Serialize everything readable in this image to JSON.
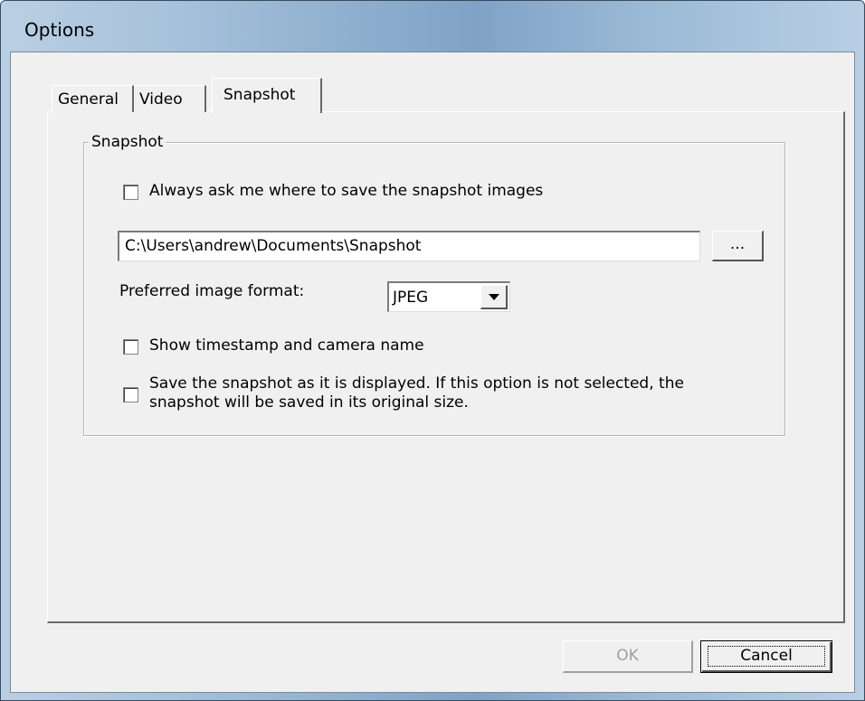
{
  "window": {
    "title": "Options"
  },
  "tabs": [
    {
      "label": "General",
      "selected": false
    },
    {
      "label": "Video",
      "selected": false
    },
    {
      "label": "Snapshot",
      "selected": true
    }
  ],
  "snapshot_group": {
    "label": "Snapshot",
    "always_ask": {
      "label": "Always ask me where to save the snapshot images",
      "checked": false
    },
    "path": {
      "value": "C:\\Users\\andrew\\Documents\\Snapshot"
    },
    "browse_label": "...",
    "format": {
      "label": "Preferred image format:",
      "selected": "JPEG"
    },
    "show_timestamp": {
      "label": "Show timestamp and camera name",
      "checked": false
    },
    "save_as_displayed": {
      "label_line1": "Save the snapshot as it is displayed. If this option is not selected, the",
      "label_line2": "snapshot will be saved in its original size.",
      "checked": false
    }
  },
  "buttons": {
    "ok_label": "OK",
    "ok_enabled": false,
    "cancel_label": "Cancel"
  },
  "icons": {
    "dropdown": "chevron-down-icon"
  }
}
